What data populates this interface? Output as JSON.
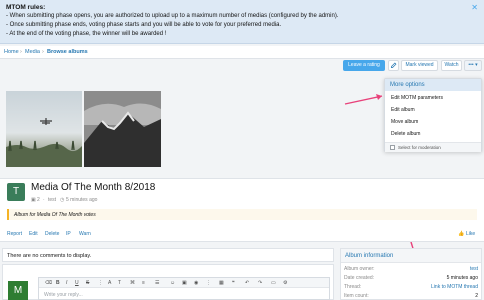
{
  "notice": {
    "title": "MTOM rules:",
    "lines": [
      "- When submitting phase opens, you are authorized to upload up to a maximum number of medias (configured by the admin).",
      "- Once submitting phase ends, voting phase starts and you will be able to vote for your preferred media.",
      "- At the end of the voting phase, the winner will be awarded !"
    ],
    "close_icon": "close-icon"
  },
  "breadcrumb": {
    "items": [
      "Home",
      "Media",
      "Browse albums"
    ],
    "separator": "›"
  },
  "toolbar": {
    "leave_rating": "Leave a rating",
    "mark_viewed": "Mark viewed",
    "watch": "Watch",
    "more": "•••"
  },
  "more_menu": {
    "title": "More options",
    "items": [
      "Edit MOTM parameters",
      "Edit album",
      "Move album",
      "Delete album"
    ],
    "moderation_label": "Select for moderation"
  },
  "album": {
    "avatar_letter": "T",
    "title": "Media Of The Month 8/2018",
    "media_count": "2",
    "author": "test",
    "time": "5 minutes ago",
    "description": "Album for Media Of The Month votes",
    "actions": [
      "Report",
      "Edit",
      "Delete",
      "IP",
      "Warn"
    ],
    "like": "Like"
  },
  "comments": {
    "empty_text": "There are no comments to display."
  },
  "reply": {
    "avatar_letter": "M",
    "placeholder": "Write your reply..."
  },
  "album_info": {
    "title": "Album information",
    "rows": [
      {
        "key": "Album owner:",
        "value": "test"
      },
      {
        "key": "Date created:",
        "value": "5 minutes ago"
      },
      {
        "key": "Thread:",
        "value": "Link to MOTM thread"
      },
      {
        "key": "Item count:",
        "value": "2"
      }
    ]
  },
  "colors": {
    "accent": "#47a7eb",
    "link": "#2577b1",
    "annotation_arrow": "#e8417a"
  }
}
